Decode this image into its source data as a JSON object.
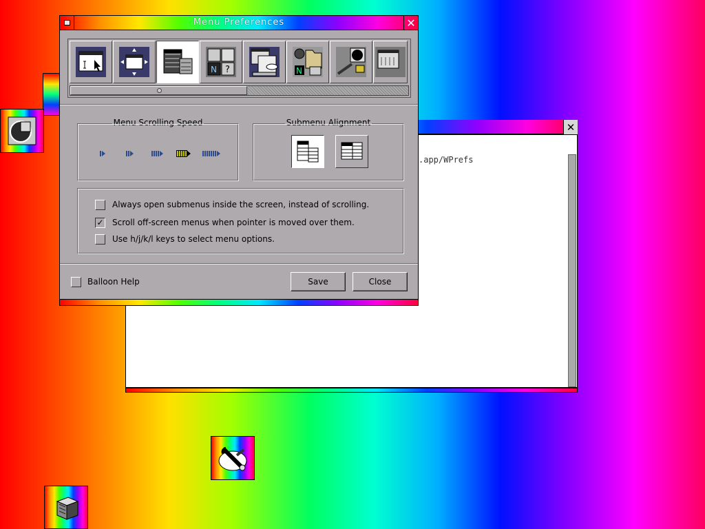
{
  "back_window": {
    "path_text": ".app/WPrefs",
    "close_icon": "close-icon"
  },
  "main_window": {
    "title": "Menu Preferences",
    "minimize_icon": "miniaturize-icon",
    "close_icon": "close-icon"
  },
  "toolbar": {
    "items": [
      {
        "icon": "window-focus-icon"
      },
      {
        "icon": "window-handling-icon"
      },
      {
        "icon": "menu-preferences-icon",
        "selected": true
      },
      {
        "icon": "icon-preferences-icon"
      },
      {
        "icon": "keyboard-shortcuts-icon"
      },
      {
        "icon": "misc-apps-icon"
      },
      {
        "icon": "appearance-icon"
      },
      {
        "icon": "workspace-icon"
      }
    ]
  },
  "scrolling_speed": {
    "title": "Menu Scrolling Speed",
    "levels": 5,
    "selected_level": 4
  },
  "submenu_alignment": {
    "title": "Submenu Alignment",
    "options": [
      {
        "icon": "submenu-aligned-top-icon",
        "selected": true
      },
      {
        "icon": "submenu-aligned-bottom-icon",
        "selected": false
      }
    ]
  },
  "options": [
    {
      "label": "Always open submenus inside the screen, instead of scrolling.",
      "checked": false
    },
    {
      "label": "Scroll off-screen menus when pointer is moved over them.",
      "checked": true
    },
    {
      "label": "Use h/j/k/l keys to select menu options.",
      "checked": false
    }
  ],
  "footer": {
    "balloon_help_label": "Balloon Help",
    "balloon_help_checked": false,
    "save_label": "Save",
    "close_label": "Close"
  },
  "desktop_icons": [
    {
      "name": "clip-icon"
    },
    {
      "name": "wprefs-dock-icon"
    },
    {
      "name": "tools-appicon"
    },
    {
      "name": "cube-appicon"
    }
  ]
}
